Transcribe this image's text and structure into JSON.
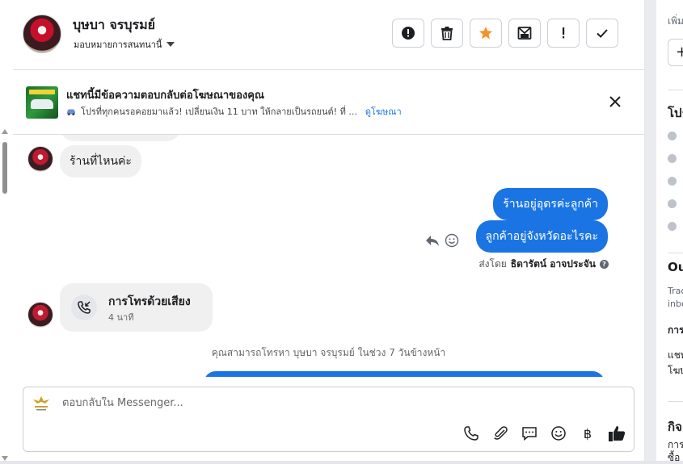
{
  "header": {
    "contact_name": "บุษบา จรบุรมย์",
    "assign_label": "มอบหมายการสนทนานี้",
    "actions": [
      {
        "name": "mark-spam-icon"
      },
      {
        "name": "trash-icon"
      },
      {
        "name": "star-icon",
        "color": "#f5922b"
      },
      {
        "name": "mark-unread-icon"
      },
      {
        "name": "follow-up-icon"
      },
      {
        "name": "mark-done-icon"
      }
    ]
  },
  "ad_banner": {
    "title": "แชทนี้มีข้อความตอบกลับต่อโฆษณาของคุณ",
    "ad_text": "โปรที่ทุกคนรอคอยมาแล้ว! เปลี่ยนเงิน 11 บาท ให้กลายเป็นรถยนต์! ที่ ...",
    "ad_link": "ดูโฆษณา"
  },
  "messages": {
    "incoming_1": "ร้านที่ไหนค่ะ",
    "outgoing_1": "ร้านอยู่อุดรค่ะลูกค้า",
    "outgoing_2": "ลูกค้าอยู่จังหวัดอะไรคะ",
    "sent_by_prefix": "ส่งโดย",
    "sent_by_name": "ธิดารัตน์ อาจประจัน",
    "help_mark": "?",
    "call_title": "การโทรด้วยเสียง",
    "call_duration": "4 นาที",
    "call_notice": "คุณสามารถโทรหา บุษบา จรบุรมย์ ในช่วง 7 วันข้างหน้า"
  },
  "composer": {
    "placeholder": "ตอบกลับใน Messenger...",
    "tools": [
      "phone-icon",
      "attach-icon",
      "saved-reply-icon",
      "emoji-icon",
      "baht-payment-icon",
      "like-icon"
    ],
    "baht_symbol": "฿"
  },
  "right_panel": {
    "top_label": "เพิ่ม",
    "add_symbol": "+",
    "profile_heading": "โปร",
    "outcomes_heading": "Ou",
    "outcomes_sub_1": "Trac",
    "outcomes_sub_2": "inbo",
    "field_label": "การ",
    "chat_source_1": "แชท",
    "chat_source_2": "โฆษ",
    "activity_heading": "กิจ",
    "activity_sub_1": "การ",
    "activity_sub_2": "ซื้อ"
  },
  "colors": {
    "brand_blue": "#1b74e4",
    "incoming_bubble": "#f0f0f0",
    "star": "#f5922b"
  }
}
